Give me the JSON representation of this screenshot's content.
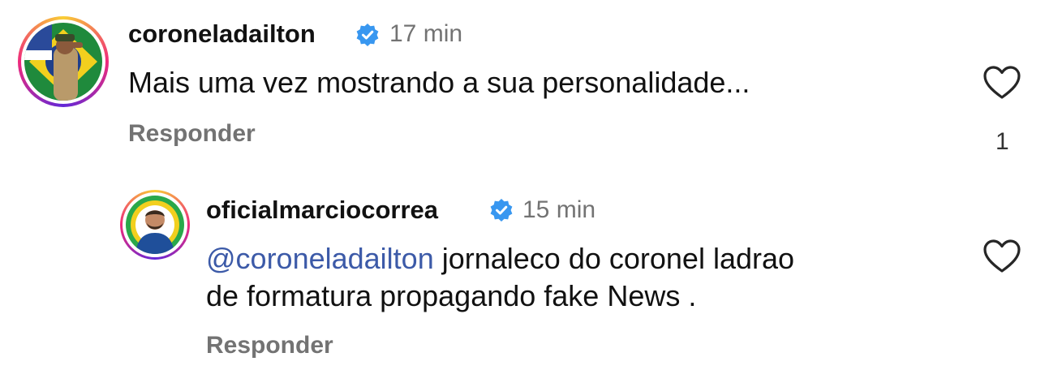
{
  "comments": [
    {
      "username": "coroneladailton",
      "time": "17 min",
      "text": "Mais uma vez mostrando a sua personalidade...",
      "reply_label": "Responder",
      "like_count": "1"
    },
    {
      "username": "oficialmarciocorrea",
      "time": "15 min",
      "mention": "@coroneladailton",
      "text_line1": " jornaleco do coronel ladrao",
      "text_line2": "de formatura propagando fake News .",
      "reply_label": "Responder"
    }
  ],
  "colors": {
    "verified": "#3897f0",
    "mention": "#3c5aa8",
    "muted": "#737373"
  },
  "icons": [
    "verified-badge-icon",
    "heart-icon"
  ]
}
